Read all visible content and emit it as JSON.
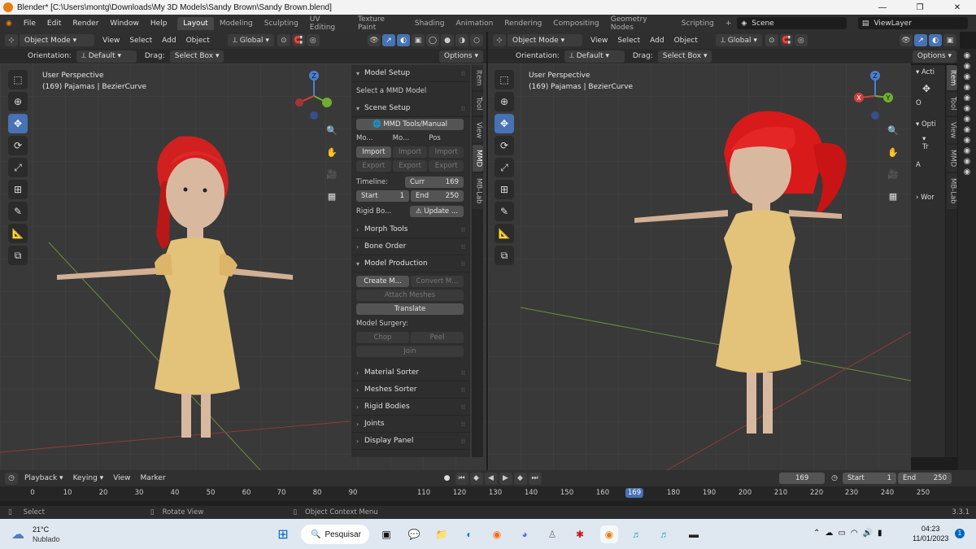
{
  "window": {
    "title": "Blender* [C:\\Users\\montg\\Downloads\\My 3D Models\\Sandy Brown\\Sandy Brown.blend]"
  },
  "menu": [
    "File",
    "Edit",
    "Render",
    "Window",
    "Help"
  ],
  "workspaces": [
    "Layout",
    "Modeling",
    "Sculpting",
    "UV Editing",
    "Texture Paint",
    "Shading",
    "Animation",
    "Rendering",
    "Compositing",
    "Geometry Nodes",
    "Scripting"
  ],
  "scene": "Scene",
  "view_layer": "ViewLayer",
  "header": {
    "mode": "Object Mode",
    "view": "View",
    "select": "Select",
    "add": "Add",
    "object": "Object",
    "orientation_global": "Global"
  },
  "subheader": {
    "orientation_label": "Orientation:",
    "orientation": "Default",
    "drag_label": "Drag:",
    "drag": "Select Box",
    "options": "Options"
  },
  "viewport": {
    "perspective": "User Perspective",
    "object": "(169) Pajamas | BezierCurve"
  },
  "gizmo": {
    "z": "Z",
    "y": "Y",
    "x": "X"
  },
  "npanel": {
    "model_setup": "Model Setup",
    "select_mmd": "Select a MMD Model",
    "scene_setup": "Scene Setup",
    "mmd_tools_manual": "MMD Tools/Manual",
    "col_a": "Mo...",
    "col_b": "Mo...",
    "col_c": "Pos",
    "import": "Import",
    "export": "Export",
    "timeline_label": "Timeline:",
    "curr_label": "Curr",
    "curr": "169",
    "start_label": "Start",
    "start": "1",
    "end_label": "End",
    "end": "250",
    "rigid_label": "Rigid Bo...",
    "update": "Update ...",
    "morph_tools": "Morph Tools",
    "bone_order": "Bone Order",
    "model_production": "Model Production",
    "create_m": "Create M...",
    "convert_m": "Convert M...",
    "attach_meshes": "Attach Meshes",
    "translate": "Translate",
    "model_surgery": "Model Surgery:",
    "chop": "Chop",
    "peel": "Peel",
    "join": "Join",
    "material_sorter": "Material Sorter",
    "meshes_sorter": "Meshes Sorter",
    "rigid_bodies": "Rigid Bodies",
    "joints": "Joints",
    "display_panel": "Display Panel"
  },
  "tabs": [
    "Item",
    "Tool",
    "View",
    "MMD",
    "MB-Lab"
  ],
  "right_npanel": {
    "acti": "Acti",
    "opti": "Opti",
    "tr": "Tr",
    "wor": "Wor",
    "o": "O",
    "a": "A"
  },
  "timeline": {
    "playback": "Playback",
    "keying": "Keying",
    "view": "View",
    "marker": "Marker",
    "current": "169",
    "start_label": "Start",
    "start": "1",
    "end_label": "End",
    "end": "250",
    "ticks": [
      "0",
      "10",
      "20",
      "30",
      "40",
      "50",
      "60",
      "70",
      "80",
      "90",
      "110",
      "120",
      "130",
      "140",
      "150",
      "160",
      "169",
      "180",
      "190",
      "200",
      "210",
      "220",
      "230",
      "240",
      "250"
    ]
  },
  "status": {
    "select": "Select",
    "rotate": "Rotate View",
    "context": "Object Context Menu",
    "version": "3.3.1"
  },
  "taskbar": {
    "temp": "21°C",
    "weather": "Nublado",
    "search": "Pesquisar",
    "time": "04:23",
    "date": "11/01/2023",
    "badge": "1"
  }
}
